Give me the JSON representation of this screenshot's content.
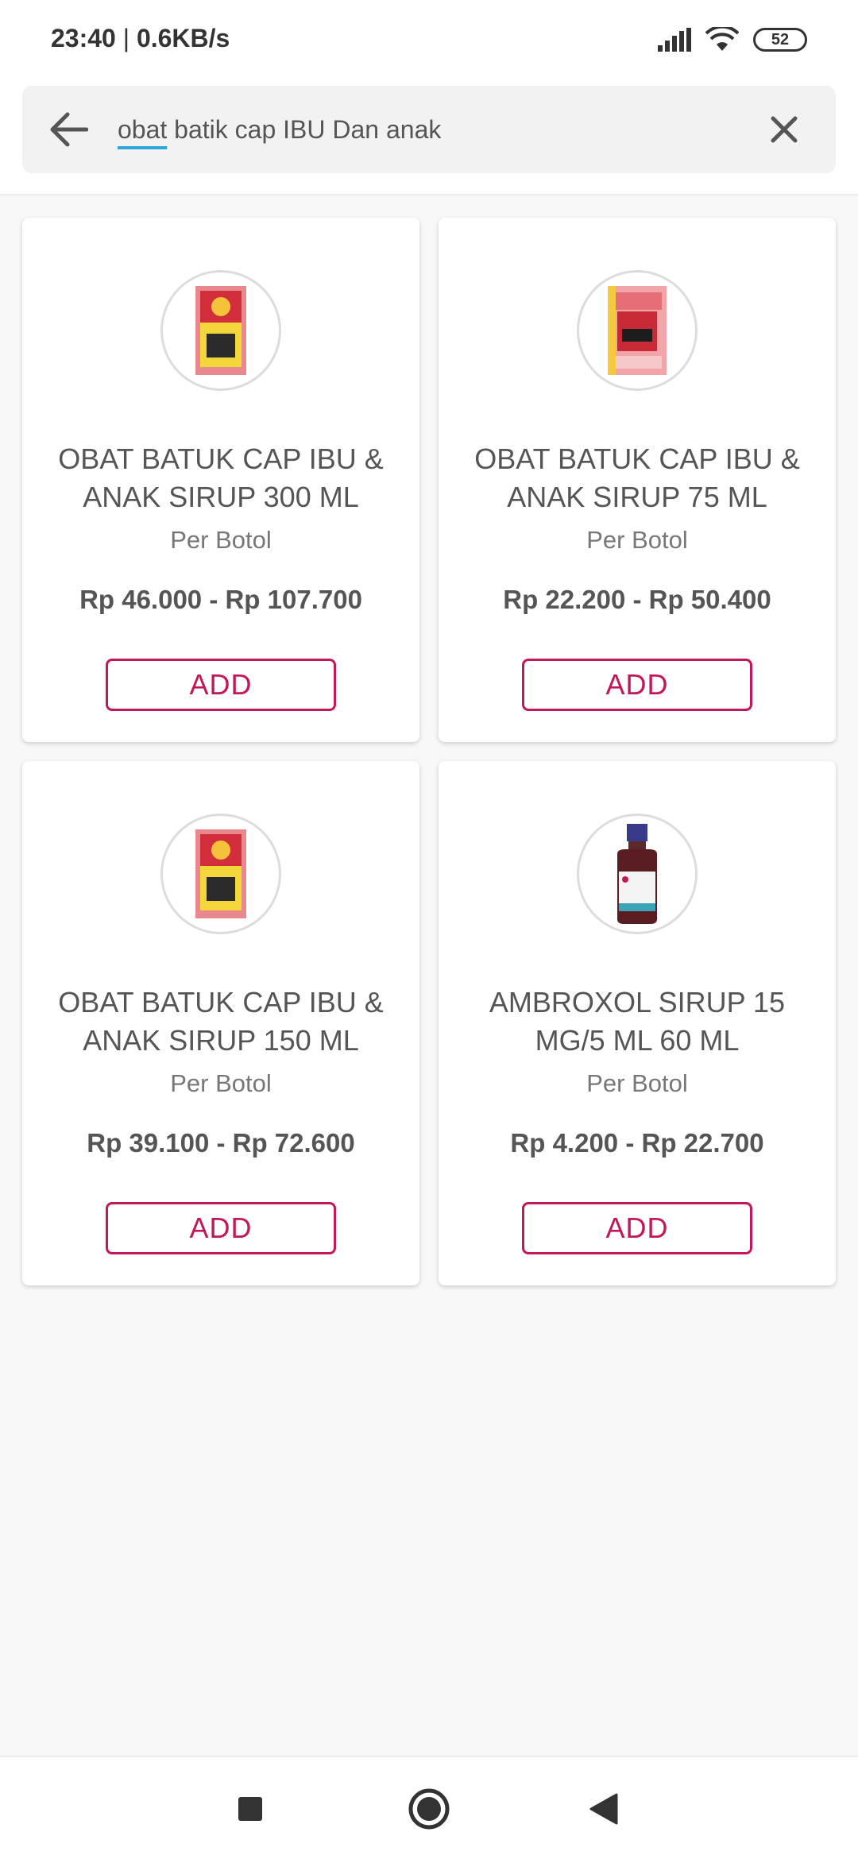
{
  "status_bar": {
    "time": "23:40",
    "separator": "|",
    "speed": "0.6KB/s",
    "battery": "52"
  },
  "search": {
    "query_highlight": "obat",
    "query_rest": " batik cap IBU Dan anak"
  },
  "products": [
    {
      "name": "OBAT BATUK CAP IBU & ANAK SIRUP 300 ML",
      "unit": "Per Botol",
      "price": "Rp 46.000 - Rp 107.700",
      "button": "ADD",
      "image": "red-yellow-box"
    },
    {
      "name": "OBAT BATUK CAP IBU & ANAK SIRUP 75 ML",
      "unit": "Per Botol",
      "price": "Rp 22.200 - Rp 50.400",
      "button": "ADD",
      "image": "pink-box"
    },
    {
      "name": "OBAT BATUK CAP IBU & ANAK SIRUP 150 ML",
      "unit": "Per Botol",
      "price": "Rp 39.100 - Rp 72.600",
      "button": "ADD",
      "image": "red-yellow-box"
    },
    {
      "name": "AMBROXOL SIRUP 15 MG/5 ML 60 ML",
      "unit": "Per Botol",
      "price": "Rp 4.200 - Rp 22.700",
      "button": "ADD",
      "image": "bottle"
    }
  ],
  "colors": {
    "accent": "#c2185b",
    "underline": "#2aa8d8"
  }
}
